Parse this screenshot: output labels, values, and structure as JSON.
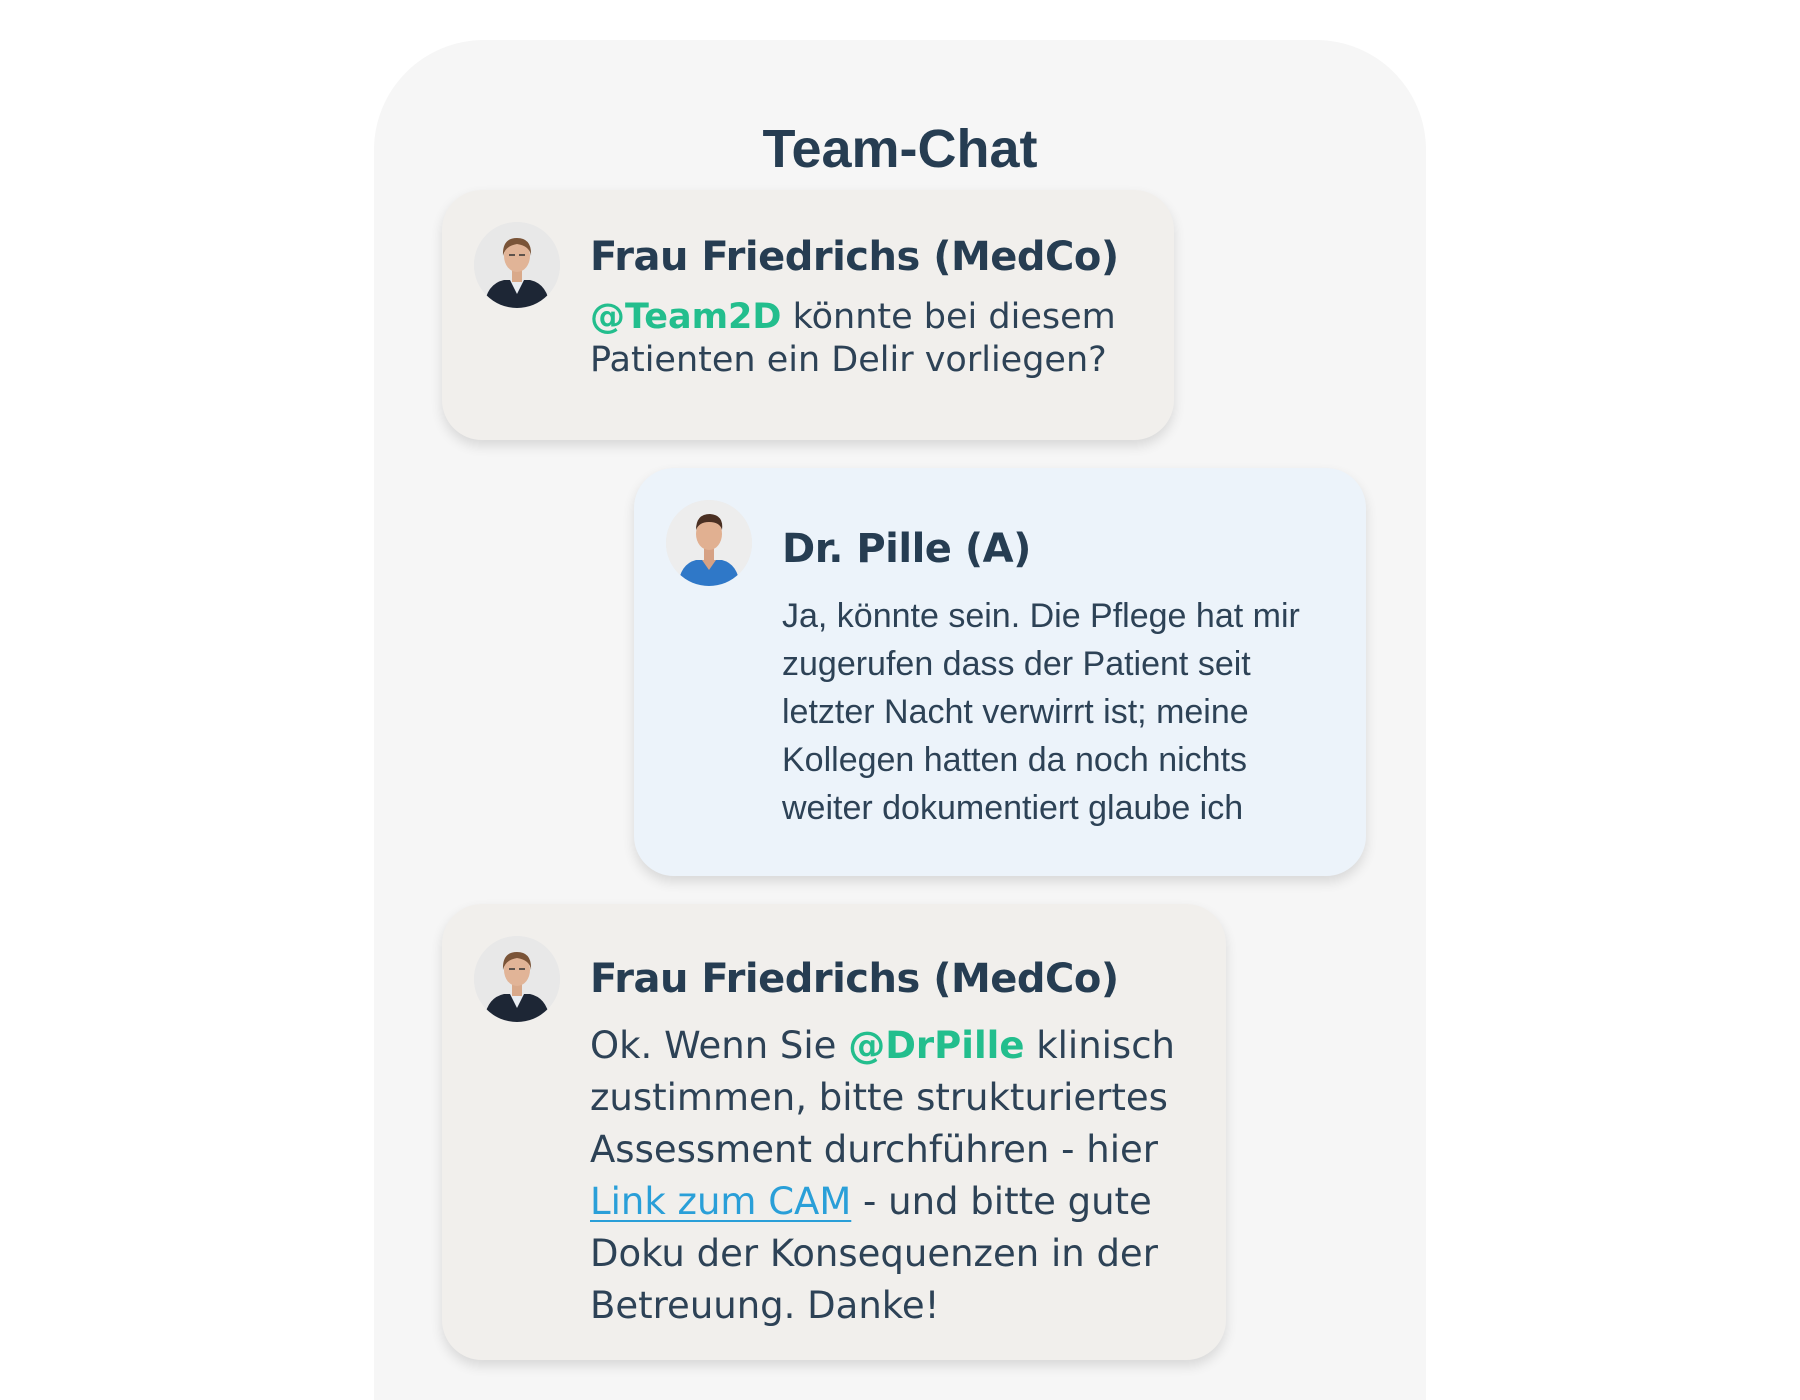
{
  "chat": {
    "title": "Team-Chat"
  },
  "messages": [
    {
      "sender": "Frau Friedrichs (MedCo)",
      "mention": "@Team2D",
      "text": "könnte bei diesem Patienten ein Delir vorliegen?"
    },
    {
      "sender": "Dr. Pille (A)",
      "text": "Ja, könnte sein. Die Pflege hat mir zugerufen dass der Patient seit letzter Nacht verwirrt ist; meine Kollegen hatten da noch nichts weiter dokumentiert glaube ich"
    },
    {
      "sender": "Frau Friedrichs (MedCo)",
      "text_before": "Ok. Wenn Sie",
      "mention": "@DrPille",
      "text_middle": "klinisch zustimmen, bitte strukturiertes Assessment durchführen - hier",
      "link": "Link zum CAM",
      "text_after": "- und bitte gute Doku der Konsequenzen in der Betreuung. Danke!"
    }
  ],
  "colors": {
    "panel": "#f6f6f6",
    "bubble_other": "#f1efec",
    "bubble_self": "#ecf3fa",
    "mention": "#23be8d",
    "link": "#2a9fd8",
    "text": "#263d52"
  },
  "icons": {
    "avatar_friedrichs": "avatar-woman-icon",
    "avatar_pille": "avatar-man-icon"
  }
}
